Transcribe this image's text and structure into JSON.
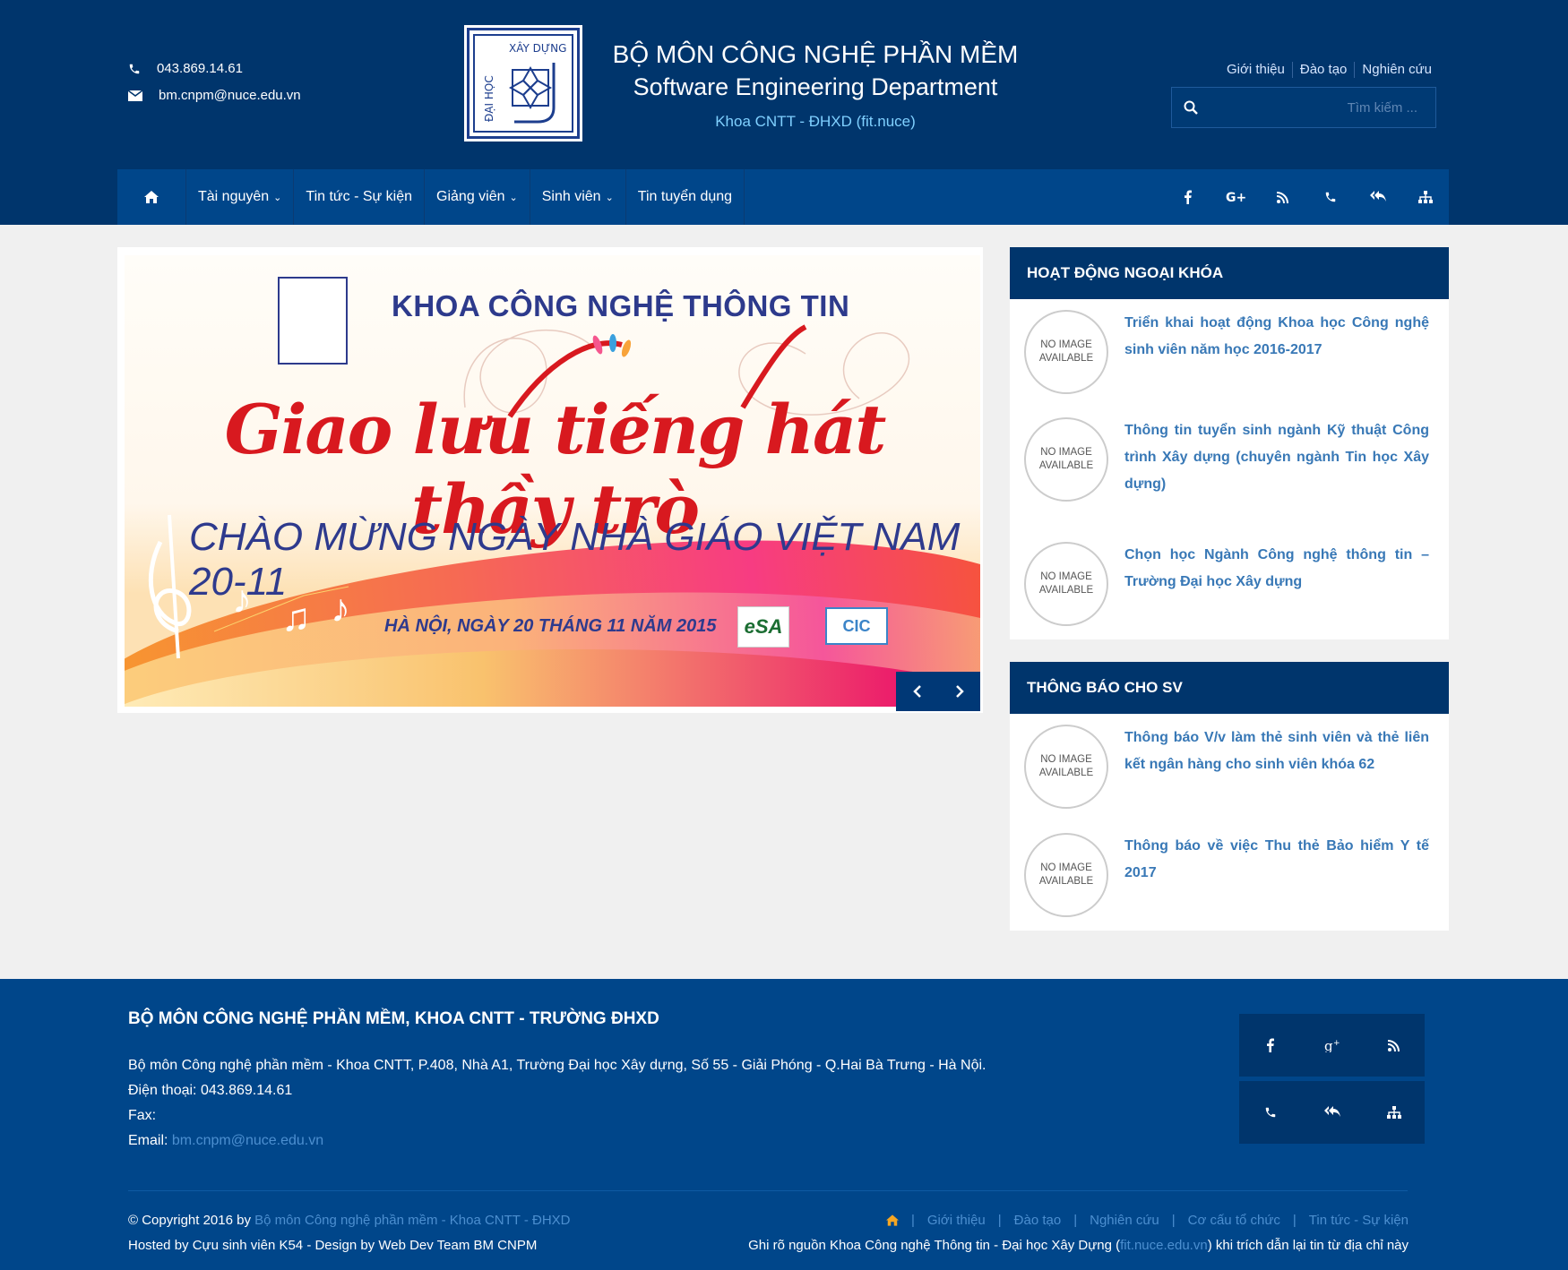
{
  "header": {
    "phone": "043.869.14.61",
    "email": "bm.cnpm@nuce.edu.vn",
    "title_vi": "BỘ MÔN CÔNG NGHỆ PHẦN MỀM",
    "title_en": "Software Engineering Department",
    "subtitle": "Khoa CNTT - ĐHXD (fit.nuce)",
    "logo_text_top": "XÂY DỰNG",
    "logo_text_side": "ĐẠI HỌC",
    "top_links": [
      "Giới thiệu",
      "Đào tạo",
      "Nghiên cứu"
    ],
    "search_placeholder": "Tìm kiếm ..."
  },
  "nav": {
    "items": [
      "Tài nguyên",
      "Tin tức - Sự kiện",
      "Giảng viên",
      "Sinh viên",
      "Tin tuyển dụng"
    ],
    "right_icons": [
      "facebook-icon",
      "google-plus-icon",
      "rss-icon",
      "phone-icon",
      "reply-icon",
      "sitemap-icon"
    ]
  },
  "slide": {
    "heading": "KHOA CÔNG NGHỆ THÔNG TIN",
    "big": "Giao lưu tiếng hát thầy trò",
    "sub": "CHÀO MỪNG NGÀY NHÀ GIÁO VIỆT NAM 20-11",
    "date": "HÀ NỘI, NGÀY 20 THÁNG 11 NĂM 2015",
    "prev": "‹",
    "next": "›"
  },
  "panels": [
    {
      "title": "HOẠT ĐỘNG NGOẠI KHÓA",
      "posts": [
        "Triển khai hoạt động Khoa học Công nghệ sinh viên năm học 2016-2017",
        "Thông tin tuyển sinh ngành Kỹ thuật Công trình Xây dựng (chuyên ngành Tin học Xây dựng)",
        "Chọn học Ngành Công nghệ thông tin – Trường Đại học Xây dựng"
      ]
    },
    {
      "title": "THÔNG BÁO CHO SV",
      "posts": [
        "Thông báo V/v làm thẻ sinh viên và thẻ liên kết ngân hàng cho sinh viên khóa 62",
        "Thông báo về việc Thu thẻ Bảo hiểm Y tế 2017"
      ]
    }
  ],
  "noimage": {
    "l1": "NO IMAGE",
    "l2": "AVAILABLE"
  },
  "footer": {
    "title": "BỘ MÔN CÔNG NGHỆ PHẦN MỀM, KHOA CNTT - TRƯỜNG ĐHXD",
    "address": "Bộ môn Công nghệ phần mềm - Khoa CNTT, P.408, Nhà A1, Trường Đại học Xây dựng, Số 55 - Giải Phóng - Q.Hai Bà Trưng - Hà Nội.",
    "phone_label": "Điện thoại:",
    "phone": "043.869.14.61",
    "fax_label": "Fax:",
    "email_label": "Email:",
    "email": "bm.cnpm@nuce.edu.vn",
    "copyright_prefix": "© Copyright 2016 by",
    "copyright_link": "Bộ môn Công nghệ phần mềm - Khoa CNTT - ĐHXD",
    "hosted": "Hosted by Cựu sinh viên K54 - Design by Web Dev Team BM CNPM",
    "links": [
      "Giới thiệu",
      "Đào tạo",
      "Nghiên cứu",
      "Cơ cấu tổ chức",
      "Tin tức - Sự kiện"
    ],
    "source_prefix": "Ghi rõ nguồn Khoa Công nghệ Thông tin - Đại học Xây Dựng (",
    "source_link": "fit.nuce.edu.vn",
    "source_suffix": ") khi trích dẫn lại tin từ địa chỉ này",
    "social_icons": [
      "facebook-icon",
      "google-plus-icon",
      "rss-icon",
      "phone-icon",
      "reply-icon",
      "sitemap-icon"
    ]
  },
  "colors": {
    "header_bg": "#00356c",
    "nav_bg": "#00468a",
    "accent_link": "#3878b6",
    "subtitle_cyan": "#7fd0ff",
    "home_orange": "#f5a623"
  }
}
